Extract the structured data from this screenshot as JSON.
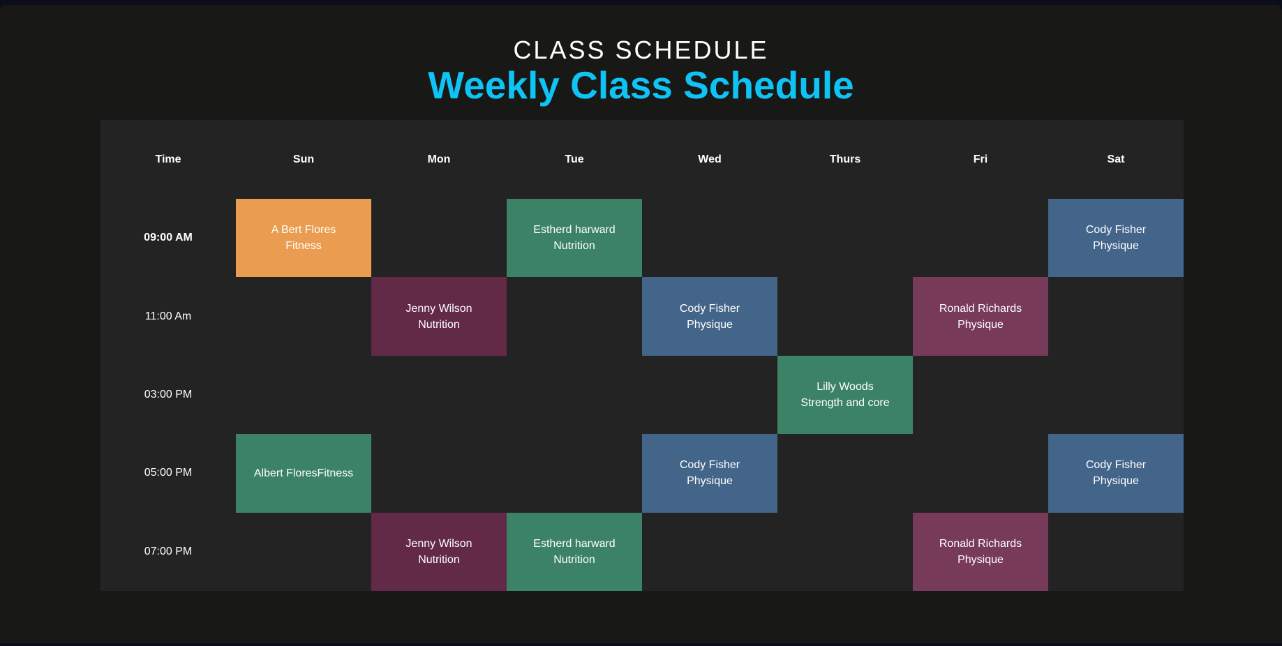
{
  "header": {
    "eyebrow": "CLASS SCHEDULE",
    "title": "Weekly Class Schedule"
  },
  "colors": {
    "title": "#0fc3f5",
    "orange": "#ea9d50",
    "green": "#3b8266",
    "plum": "#632a48",
    "blue": "#436589",
    "rose": "#773a59"
  },
  "table": {
    "time_header": "Time",
    "days": [
      "Sun",
      "Mon",
      "Tue",
      "Wed",
      "Thurs",
      "Fri",
      "Sat"
    ],
    "rows": [
      {
        "time": "09:00 AM",
        "bold": true,
        "cells": [
          {
            "name": "A Bert Flores",
            "class": "Fitness",
            "color": "#ea9d50"
          },
          null,
          {
            "name": "Estherd harward",
            "class": "Nutrition",
            "color": "#3b8266"
          },
          null,
          null,
          null,
          {
            "name": "Cody Fisher",
            "class": "Physique",
            "color": "#436589"
          }
        ]
      },
      {
        "time": "11:00 Am",
        "bold": false,
        "cells": [
          null,
          {
            "name": "Jenny Wilson",
            "class": "Nutrition",
            "color": "#632a48"
          },
          null,
          {
            "name": "Cody Fisher",
            "class": "Physique",
            "color": "#436589"
          },
          null,
          {
            "name": "Ronald Richards",
            "class": "Physique",
            "color": "#773a59"
          },
          null
        ]
      },
      {
        "time": "03:00 PM",
        "bold": false,
        "cells": [
          null,
          null,
          null,
          null,
          {
            "name": "Lilly Woods",
            "class": "Strength and core",
            "color": "#3b8266"
          },
          null,
          null
        ]
      },
      {
        "time": "05:00 PM",
        "bold": false,
        "cells": [
          {
            "name": "Albert FloresFitness",
            "class": "",
            "color": "#3b8266"
          },
          null,
          null,
          {
            "name": "Cody Fisher",
            "class": "Physique",
            "color": "#436589"
          },
          null,
          null,
          {
            "name": "Cody Fisher",
            "class": "Physique",
            "color": "#436589"
          }
        ]
      },
      {
        "time": "07:00 PM",
        "bold": false,
        "cells": [
          null,
          {
            "name": "Jenny Wilson",
            "class": "Nutrition",
            "color": "#632a48"
          },
          {
            "name": "Estherd harward",
            "class": "Nutrition",
            "color": "#3b8266"
          },
          null,
          null,
          {
            "name": "Ronald Richards",
            "class": "Physique",
            "color": "#773a59"
          },
          null
        ]
      }
    ]
  }
}
